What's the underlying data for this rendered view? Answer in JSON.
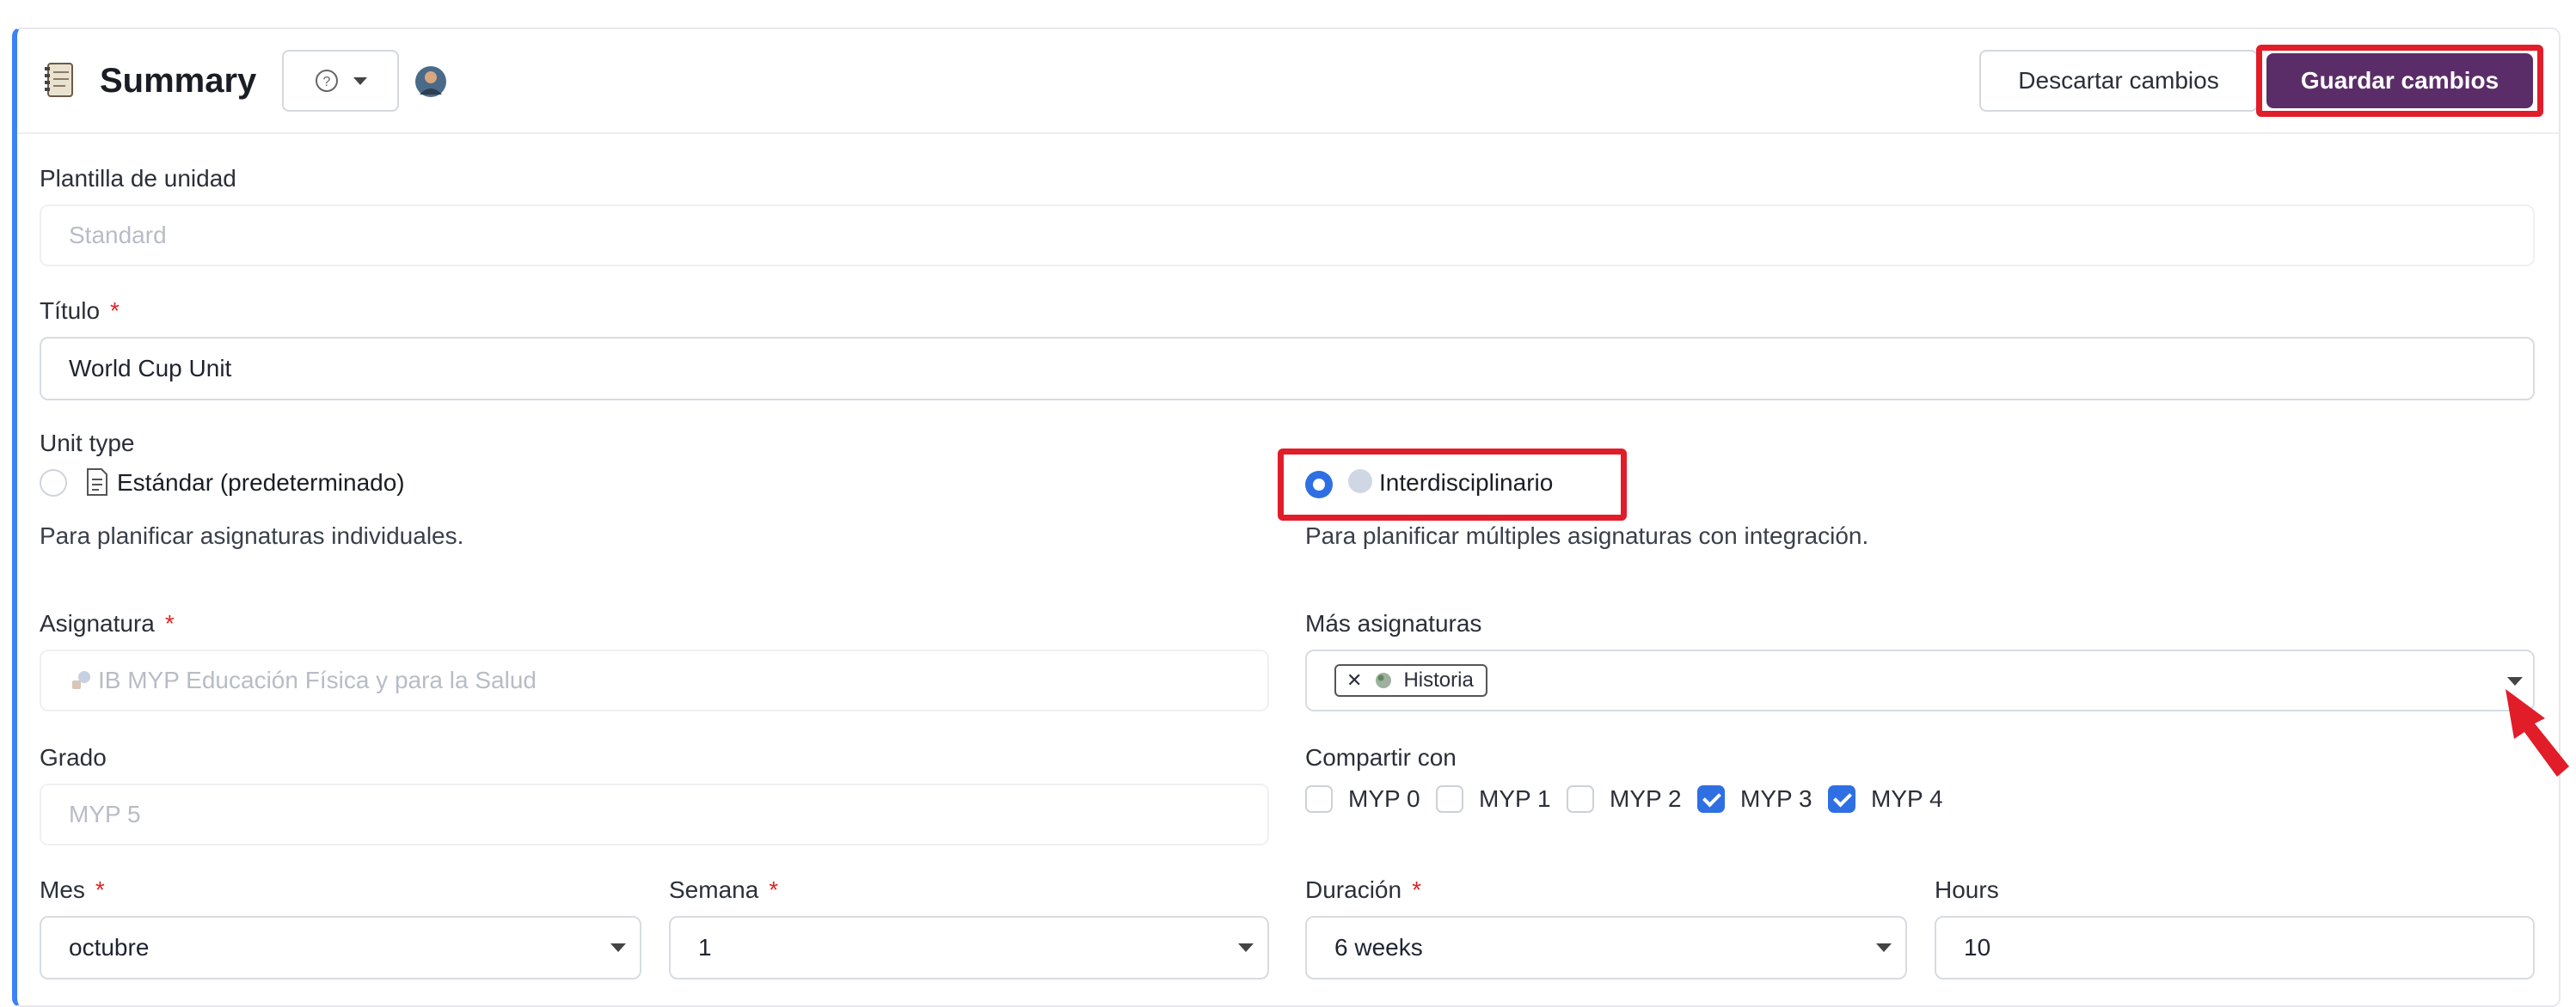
{
  "header": {
    "title": "Summary",
    "help_icon": "question-circle-icon",
    "discard_label": "Descartar cambios",
    "save_label": "Guardar cambios"
  },
  "form": {
    "template": {
      "label": "Plantilla de unidad",
      "placeholder": "Standard"
    },
    "title": {
      "label": "Título",
      "required": "*",
      "value": "World Cup Unit"
    },
    "unit_type": {
      "label": "Unit type",
      "standard": {
        "label": "Estándar (predeterminado)",
        "helper": "Para planificar asignaturas individuales.",
        "selected": false
      },
      "interdisciplinary": {
        "label": "Interdisciplinario",
        "helper": "Para planificar múltiples asignaturas con integración.",
        "selected": true
      }
    },
    "subject": {
      "label": "Asignatura",
      "required": "*",
      "placeholder": "IB MYP Educación Física y para la Salud"
    },
    "more_subjects": {
      "label": "Más asignaturas",
      "tags": [
        "Historia"
      ],
      "remove_glyph": "✕"
    },
    "grade": {
      "label": "Grado",
      "placeholder": "MYP 5"
    },
    "share": {
      "label": "Compartir con",
      "options": [
        {
          "label": "MYP 0",
          "checked": false
        },
        {
          "label": "MYP 1",
          "checked": false
        },
        {
          "label": "MYP 2",
          "checked": false
        },
        {
          "label": "MYP 3",
          "checked": true
        },
        {
          "label": "MYP 4",
          "checked": true
        }
      ]
    },
    "month": {
      "label": "Mes",
      "required": "*",
      "value": "octubre"
    },
    "week": {
      "label": "Semana",
      "required": "*",
      "value": "1"
    },
    "duration": {
      "label": "Duración",
      "required": "*",
      "value": "6 weeks"
    },
    "hours": {
      "label": "Hours",
      "value": "10"
    }
  },
  "colors": {
    "accent": "#5b2d68",
    "highlight": "#e11d2a",
    "check": "#2f6fe4",
    "left_border": "#3b82f6"
  }
}
